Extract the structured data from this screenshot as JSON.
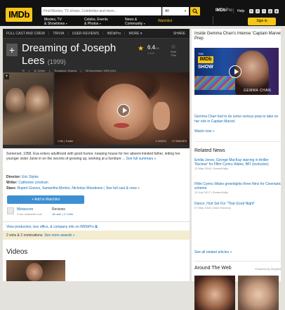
{
  "nav": {
    "logo": "IMDb",
    "search_placeholder": "Find Movies, TV shows, Celebrities and more...",
    "search_category": "All",
    "menus": [
      {
        "l1": "Movies, TV",
        "l2": "& Showtimes"
      },
      {
        "l1": "Celebs, Events",
        "l2": "& Photos"
      },
      {
        "l1": "News &",
        "l2": "Community"
      }
    ],
    "watchlist": "Watchlist",
    "imdbpro": "IMDb",
    "imdbpro_suffix": "Pro",
    "help": "Help",
    "signin": "Sign in",
    "socials": [
      "f",
      "t",
      "i",
      "y",
      "p"
    ]
  },
  "subnav": {
    "items": [
      "FULL CAST AND CREW",
      "TRIVIA",
      "USER REVIEWS",
      "IMDbPro",
      "MORE"
    ],
    "share": "SHARE"
  },
  "title": {
    "name": "Dreaming of Joseph Lees",
    "year": "(1999)",
    "certificate": "R",
    "runtime": "1h 32min",
    "genres": "Romance, Drama",
    "release": "26 November 1999 (UK)"
  },
  "rating": {
    "value": "6.4",
    "scale": "/10",
    "count": "1,116",
    "rate_label_1": "Rate",
    "rate_label_2": "This"
  },
  "media": {
    "poster_caption": "Dreaming of Joseph Lees",
    "trailer_label": "1:56 | Trailer",
    "video_count": "1 VIDEO",
    "image_count": "17 IMAGES"
  },
  "plot": {
    "text": "Somerset, 1958. Eva enters adulthood with good humor, keeping house for her absent-minded father, letting her younger sister Janie in on the secrets of growing up, working at a furniture ...",
    "see_full": "See full summary »"
  },
  "credits": {
    "director_label": "Director:",
    "director": "Eric Styles",
    "writer_label": "Writer:",
    "writer": "Catherine Linstrum",
    "stars_label": "Stars:",
    "stars": "Rupert Graves, Samantha Morton, Nicholas Woodeson",
    "see_full_cast": "See full cast & crew »"
  },
  "watchlist_btn": "+ Add to Watchlist",
  "metascore": {
    "label": "Metascore",
    "sub": "From metacritic.com"
  },
  "reviews": {
    "label": "Reviews",
    "sub": "18 user | 17 critic"
  },
  "production_link": "View production, box office, & company info on IMDbPro",
  "awards": {
    "text": "2 wins & 2 nominations.",
    "link": "See more awards »"
  },
  "videos_heading": "Videos",
  "sidebar": {
    "promo_title": "Inside Gemma Chan's Intense 'Captain Marvel' Prep",
    "promo": {
      "the": "THE",
      "badge": "IMDb",
      "show": "SHOW",
      "name": "GEMMA CHAN"
    },
    "promo_desc_pre": "Gemma Chan had to do some serious prep to take on her role in ",
    "promo_desc_link": "Captain Marvel",
    "promo_desc_post": ".",
    "watch_now": "Watch now »",
    "related_heading": "Related News",
    "news": [
      {
        "title": "Emilia Jones, George MacKay starring in thriller 'Nuclear' for Ffilm Cymru Wales, BFI (exclusive)",
        "meta": "12 May 2018 | ScreenDaily"
      },
      {
        "title": "Ffilm Cymru Wales greenlights three films for Cinematic scheme",
        "meta": "13 July 2017 | ScreenDaily"
      },
      {
        "title": "Dance, Hurt Set For \"That Good Night\"",
        "meta": "07 May 2016 | Dark Horizons"
      }
    ],
    "all_related": "See all related articles »",
    "around_heading": "Around The Web",
    "powered": "Powered by ZergNet"
  }
}
